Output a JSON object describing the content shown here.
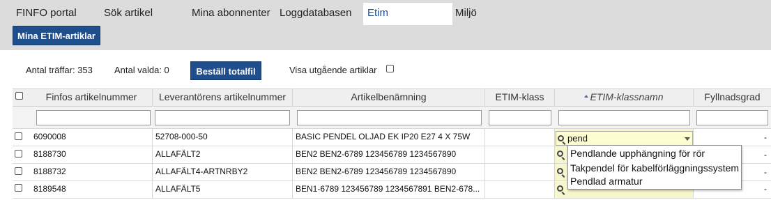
{
  "nav": {
    "items": [
      "FINFO portal",
      "Sök artikel",
      "Mina abonnenter",
      "Loggdatabasen",
      "Etim",
      "Miljö"
    ],
    "active_index": 4,
    "sub_button": "Mina ETIM-artiklar"
  },
  "toolbar": {
    "hits": "Antal träffar: 353",
    "selected": "Antal valda: 0",
    "order_button": "Beställ totalfil",
    "show_outgoing_label": "Visa utgående artiklar",
    "show_outgoing_checked": false
  },
  "table": {
    "columns": [
      "Finfos artikelnummer",
      "Leverantörens artikelnummer",
      "Artikelbenämning",
      "ETIM-klass",
      "ETIM-klassnamn",
      "Fyllnadsgrad"
    ],
    "sorted_column_index": 4,
    "rows": [
      {
        "finfo": "6090008",
        "supplier": "52708-000-50",
        "name": "BASIC PENDEL OLJAD EK IP20 E27 4 X 75W",
        "etim_class": "",
        "etim_name": "pend",
        "fill": "-"
      },
      {
        "finfo": "8188730",
        "supplier": "ALLAFÄLT2",
        "name": "BEN2 BEN2-6789 123456789 1234567890",
        "etim_class": "",
        "etim_name": "",
        "fill": "-"
      },
      {
        "finfo": "8188732",
        "supplier": "ALLAFÄLT4-ARTNRBY2",
        "name": "BEN2 BEN2-6789 123456789 1234567890",
        "etim_class": "",
        "etim_name": "",
        "fill": "-"
      },
      {
        "finfo": "8189548",
        "supplier": "ALLAFÄLT5",
        "name": "BEN1-6789 123456789 1234567891 BEN2-678...",
        "etim_class": "",
        "etim_name": "",
        "fill": "-"
      }
    ]
  },
  "autocomplete": {
    "query": "pend",
    "options": [
      "Pendlande upphängning för rör",
      "Takpendel för kabelförläggningssystem",
      "Pendlad armatur"
    ]
  },
  "colors": {
    "topbar": "#dcdcdc",
    "primary_button": "#1f4e8c",
    "etim_cell": "#f7f7cf"
  }
}
